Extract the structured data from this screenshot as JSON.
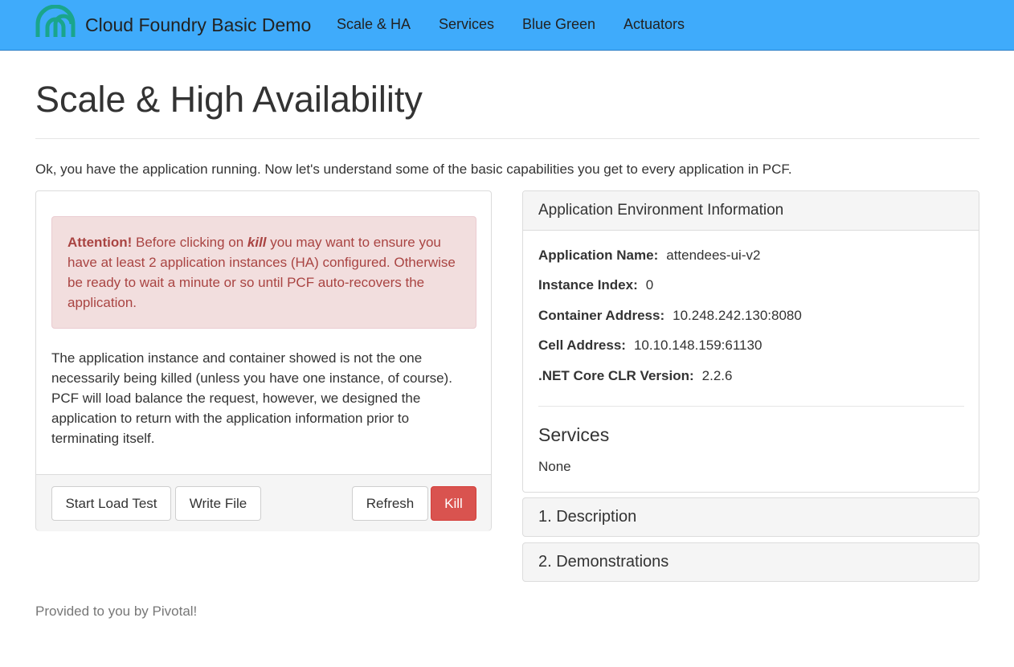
{
  "navbar": {
    "brand": "Cloud Foundry Basic Demo",
    "links": [
      "Scale & HA",
      "Services",
      "Blue Green",
      "Actuators"
    ],
    "colors": {
      "background": "#3fabfb",
      "logo": "#1aa58c"
    },
    "logo_icon": "cloud-foundry-logo-icon"
  },
  "page": {
    "title": "Scale & High Availability",
    "intro": "Ok, you have the application running. Now let's understand some of the basic capabilities you get to every application in PCF."
  },
  "alert": {
    "strong": "Attention!",
    "text_before": " Before clicking on ",
    "kill_word": "kill",
    "text_after": " you may want to ensure you have at least 2 application instances (HA) configured. Otherwise be ready to wait a minute or so until PCF auto-recovers the application."
  },
  "left_body": "The application instance and container showed is not the one necessarily being killed (unless you have one instance, of course). PCF will load balance the request, however, we designed the application to return with the application information prior to terminating itself.",
  "buttons": {
    "start_load_test": "Start Load Test",
    "write_file": "Write File",
    "refresh": "Refresh",
    "kill": "Kill"
  },
  "env": {
    "heading": "Application Environment Information",
    "rows": [
      {
        "label": "Application Name:",
        "value": "attendees-ui-v2"
      },
      {
        "label": "Instance Index:",
        "value": "0"
      },
      {
        "label": "Container Address:",
        "value": "10.248.242.130:8080"
      },
      {
        "label": "Cell Address:",
        "value": "10.10.148.159:61130"
      },
      {
        "label": ".NET Core CLR Version:",
        "value": "2.2.6"
      }
    ],
    "services_title": "Services",
    "services_value": "None"
  },
  "accordion": [
    "1. Description",
    "2. Demonstrations"
  ],
  "footer": "Provided to you by Pivotal!"
}
